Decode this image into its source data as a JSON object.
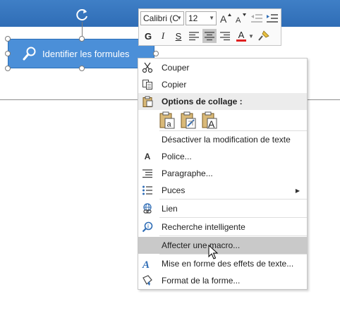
{
  "shape": {
    "label": "Identifier les formules"
  },
  "mini_toolbar": {
    "font_name": "Calibri (C",
    "font_size": "12",
    "bold": "G",
    "italic": "I",
    "underline": "S",
    "font_color": "A",
    "font_color_hex": "#e02020"
  },
  "menu": {
    "items": [
      {
        "label": "Couper",
        "icon": "scissors-icon"
      },
      {
        "label": "Copier",
        "icon": "copy-icon"
      },
      {
        "label": "Options de collage :",
        "icon": "clipboard-icon"
      },
      {
        "label": "Désactiver la modification de texte",
        "icon": ""
      },
      {
        "label": "Police...",
        "icon": "font-icon"
      },
      {
        "label": "Paragraphe...",
        "icon": "paragraph-icon"
      },
      {
        "label": "Puces",
        "icon": "bullets-icon"
      },
      {
        "label": "Lien",
        "icon": "link-icon"
      },
      {
        "label": "Recherche intelligente",
        "icon": "smart-lookup-icon"
      },
      {
        "label": "Affecter une macro...",
        "icon": ""
      },
      {
        "label": "Mise en forme des effets de texte...",
        "icon": "text-effects-icon"
      },
      {
        "label": "Format de la forme...",
        "icon": "format-shape-icon"
      }
    ],
    "paste_option_letters": [
      "a",
      "A"
    ]
  }
}
